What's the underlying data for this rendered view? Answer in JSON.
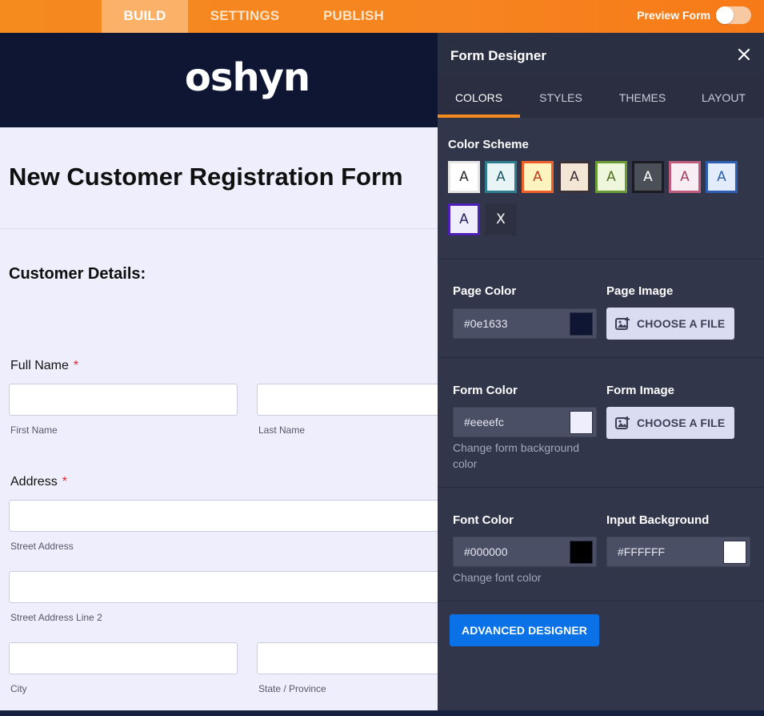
{
  "topbar": {
    "tabs": [
      {
        "label": "BUILD",
        "active": true
      },
      {
        "label": "SETTINGS",
        "active": false
      },
      {
        "label": "PUBLISH",
        "active": false
      }
    ],
    "preview_label": "Preview Form",
    "preview_enabled": false
  },
  "form": {
    "logo": "oshyn",
    "title": "New Customer Registration Form",
    "section": "Customer Details:",
    "full_name": {
      "label": "Full Name",
      "required": "*",
      "first": "First Name",
      "last": "Last Name"
    },
    "address": {
      "label": "Address",
      "required": "*",
      "street": "Street Address",
      "street2": "Street Address Line 2",
      "city": "City",
      "state": "State / Province"
    }
  },
  "designer": {
    "title": "Form Designer",
    "tabs": [
      {
        "label": "COLORS",
        "active": true
      },
      {
        "label": "STYLES",
        "active": false
      },
      {
        "label": "THEMES",
        "active": false
      },
      {
        "label": "LAYOUT",
        "active": false
      }
    ],
    "color_scheme_label": "Color Scheme",
    "swatches": [
      {
        "letter": "A",
        "bg": "#ffffff",
        "border": "#e6e6e6",
        "fg": "#2b2b2b"
      },
      {
        "letter": "A",
        "bg": "#e8f4f6",
        "border": "#2e7e90",
        "fg": "#1c5a68"
      },
      {
        "letter": "A",
        "bg": "#fff3c0",
        "border": "#f0602a",
        "fg": "#c33b17"
      },
      {
        "letter": "A",
        "bg": "#f3e6d4",
        "border": "#3a3035",
        "fg": "#3a3035"
      },
      {
        "letter": "A",
        "bg": "#eef6dc",
        "border": "#6c9a35",
        "fg": "#4f7323"
      },
      {
        "letter": "A",
        "bg": "#4b4f58",
        "border": "#1a1c22",
        "fg": "#ffffff"
      },
      {
        "letter": "A",
        "bg": "#f6eef2",
        "border": "#c05c7e",
        "fg": "#a43e62"
      },
      {
        "letter": "A",
        "bg": "#e2ecfb",
        "border": "#2f5fb2",
        "fg": "#2f5fb2"
      },
      {
        "letter": "A",
        "bg": "#eeeefc",
        "border": "#4b1fb8",
        "fg": "#2a1f5c"
      },
      {
        "letter": "X",
        "bg": "#2c3040",
        "border": "#2c3040",
        "fg": "#ffffff"
      }
    ],
    "page_color": {
      "label": "Page Color",
      "value": "#0e1633",
      "chip": "#0e1633"
    },
    "page_image": {
      "label": "Page Image",
      "button": "CHOOSE A FILE"
    },
    "form_color": {
      "label": "Form Color",
      "value": "#eeeefc",
      "chip": "#eeeefc",
      "help": "Change form background color"
    },
    "form_image": {
      "label": "Form Image",
      "button": "CHOOSE A FILE"
    },
    "font_color": {
      "label": "Font Color",
      "value": "#000000",
      "chip": "#000000",
      "help": "Change font color"
    },
    "input_background": {
      "label": "Input Background",
      "value": "#FFFFFF",
      "chip": "#ffffff"
    },
    "advanced_button": "ADVANCED DESIGNER"
  }
}
